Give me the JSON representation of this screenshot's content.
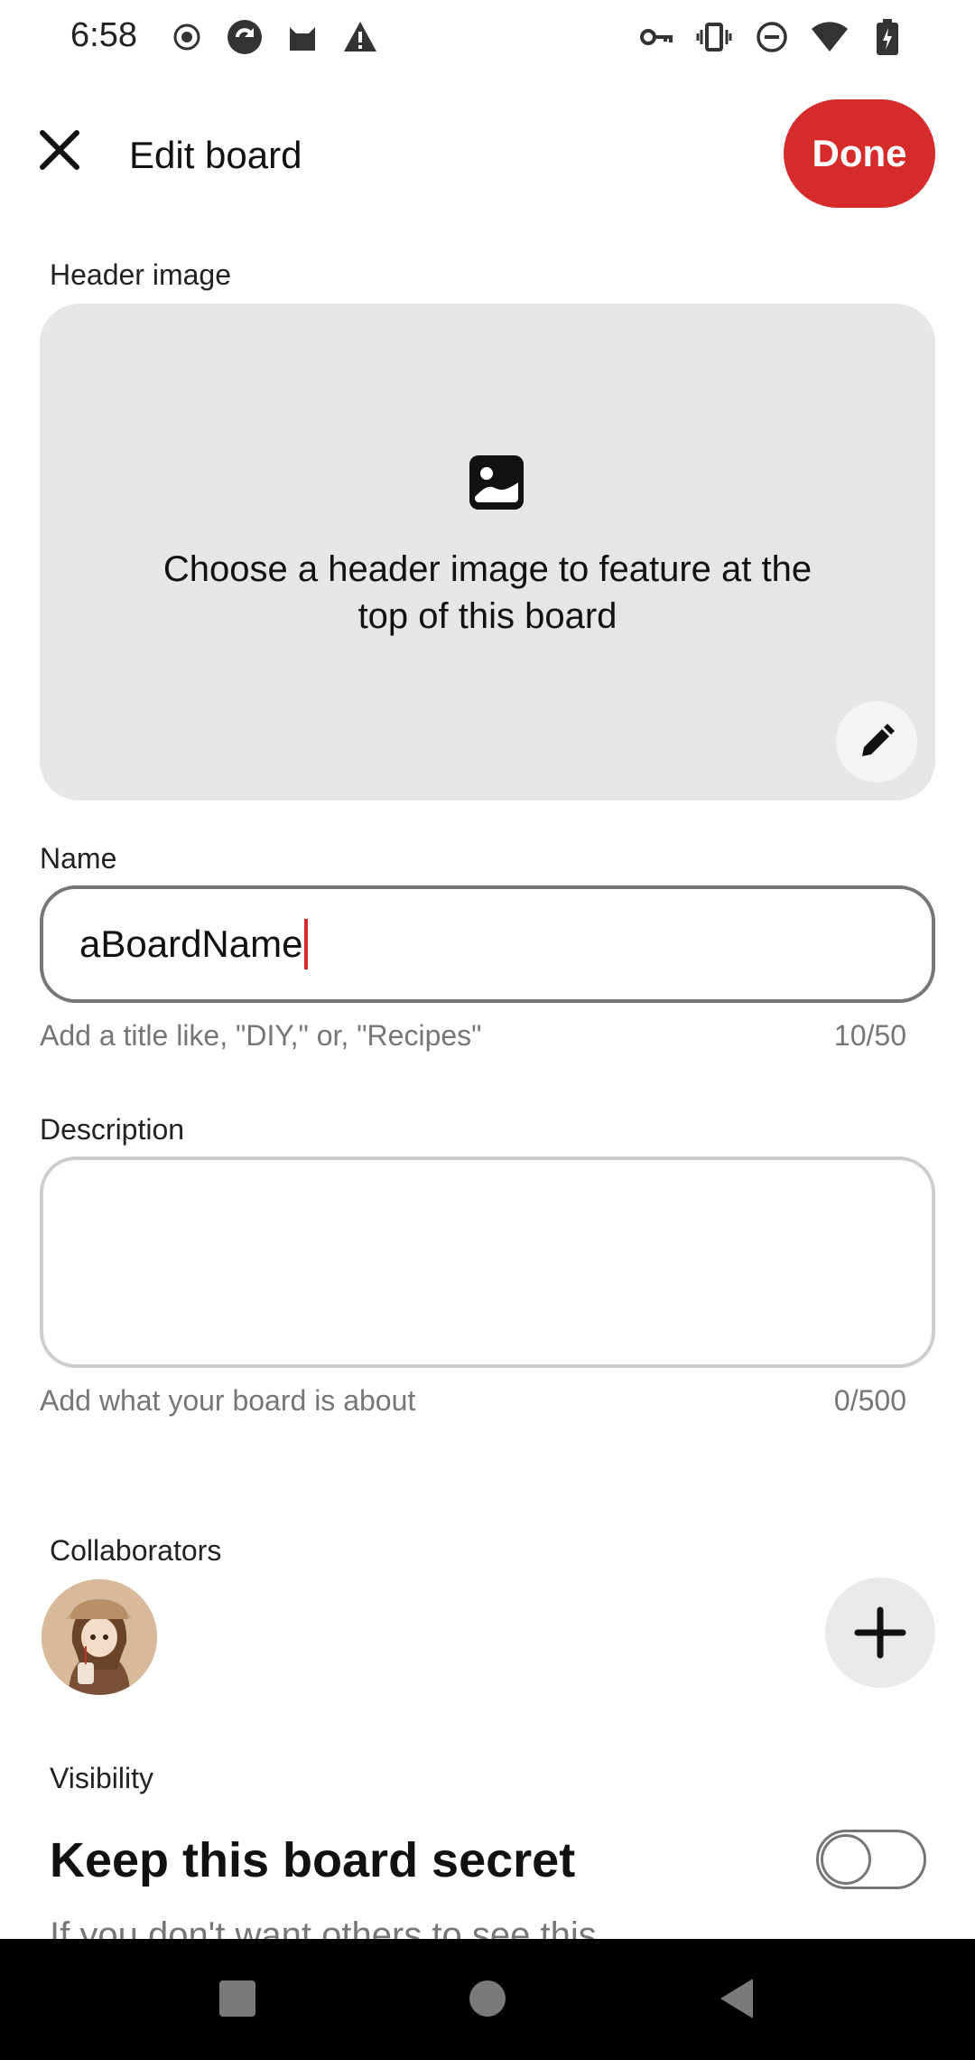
{
  "status_bar": {
    "time": "6:58",
    "left_icons": [
      "record-icon",
      "sync-icon",
      "cat-icon",
      "warning-icon"
    ],
    "right_icons": [
      "key-icon",
      "vibrate-icon",
      "dnd-icon",
      "wifi-icon",
      "battery-icon"
    ]
  },
  "header": {
    "title": "Edit board",
    "done_label": "Done",
    "accent_color": "#d62b2b"
  },
  "header_image": {
    "label": "Header image",
    "prompt": "Choose a header image to feature at the top of this board"
  },
  "name": {
    "label": "Name",
    "value": "aBoardName",
    "helper": "Add a title like, \"DIY,\" or, \"Recipes\"",
    "counter": "10/50"
  },
  "description": {
    "label": "Description",
    "value": "",
    "helper": "Add what your board is about",
    "counter": "0/500"
  },
  "collaborators": {
    "label": "Collaborators"
  },
  "visibility": {
    "label": "Visibility",
    "secret_title": "Keep this board secret",
    "secret_desc": "If you don't want others to see this",
    "secret_enabled": false
  },
  "nav": {
    "icons": [
      "recents-icon",
      "home-icon",
      "back-icon"
    ]
  }
}
